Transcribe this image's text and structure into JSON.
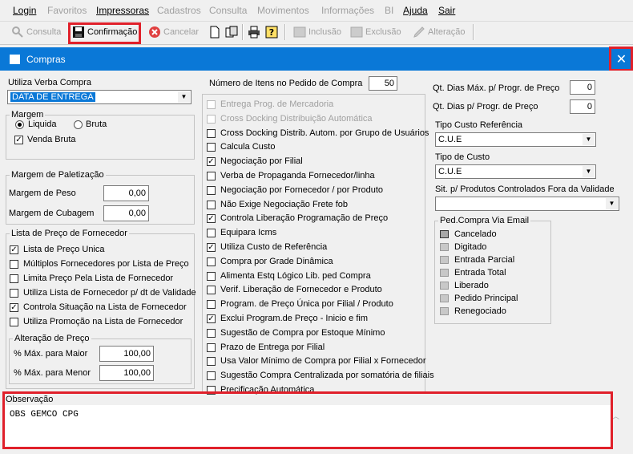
{
  "menu": [
    {
      "label": "Login",
      "enabled": true
    },
    {
      "label": "Favoritos",
      "enabled": false
    },
    {
      "label": "Impressoras",
      "enabled": true
    },
    {
      "label": "Cadastros",
      "enabled": false
    },
    {
      "label": "Consulta",
      "enabled": false
    },
    {
      "label": "Movimentos",
      "enabled": false
    },
    {
      "label": "Informações",
      "enabled": false
    },
    {
      "label": "BI",
      "enabled": false
    },
    {
      "label": "Ajuda",
      "enabled": true
    },
    {
      "label": "Sair",
      "enabled": true
    }
  ],
  "toolbar": {
    "consulta": "Consulta",
    "confirmacao": "Confirmação",
    "cancelar": "Cancelar",
    "inclusao": "Inclusão",
    "exclusao": "Exclusão",
    "alteracao": "Alteração"
  },
  "window": {
    "title": "Compras"
  },
  "col1": {
    "verba_label": "Utiliza Verba Compra",
    "verba_value": "DATA DE ENTREGA",
    "margem_title": "Margem",
    "margem_liquida": "Liquida",
    "margem_bruta": "Bruta",
    "venda_bruta": "Venda Bruta",
    "paletizacao_title": "Margem de Paletização",
    "margem_peso_label": "Margem de Peso",
    "margem_peso_value": "0,00",
    "margem_cubagem_label": "Margem de Cubagem",
    "margem_cubagem_value": "0,00",
    "lista_title": "Lista de Preço de Fornecedor",
    "lista_items": [
      {
        "label": "Lista de Preço Unica",
        "checked": true
      },
      {
        "label": "Múltiplos Fornecedores por Lista de Preço",
        "checked": false
      },
      {
        "label": "Limita Preço Pela Lista de Fornecedor",
        "checked": false
      },
      {
        "label": "Utiliza Lista de Fornecedor p/ dt de Validade",
        "checked": false
      },
      {
        "label": "Controla Situação na Lista de Fornecedor",
        "checked": true
      },
      {
        "label": "Utiliza Promoção na Lista de Fornecedor",
        "checked": false
      }
    ],
    "alteracao_title": "Alteração de Preço",
    "max_maior_label": "% Máx. para Maior",
    "max_maior_value": "100,00",
    "max_menor_label": "% Máx. para Menor",
    "max_menor_value": "100,00"
  },
  "col2": {
    "itens_label": "Número de Itens no Pedido de Compra",
    "itens_value": "50",
    "options": [
      {
        "label": "Entrega Prog. de Mercadoria",
        "checked": false,
        "enabled": false
      },
      {
        "label": "Cross Docking Distribuição Automática",
        "checked": false,
        "enabled": false
      },
      {
        "label": "Cross Docking Distrib. Autom. por Grupo de Usuários",
        "checked": false,
        "enabled": true
      },
      {
        "label": "Calcula Custo",
        "checked": false,
        "enabled": true
      },
      {
        "label": "Negociação por Filial",
        "checked": true,
        "enabled": true
      },
      {
        "label": "Verba de Propaganda Fornecedor/linha",
        "checked": false,
        "enabled": true
      },
      {
        "label": "Negociação por Fornecedor / por Produto",
        "checked": false,
        "enabled": true
      },
      {
        "label": "Não Exige Negociação Frete fob",
        "checked": false,
        "enabled": true
      },
      {
        "label": "Controla Liberação Programação de Preço",
        "checked": true,
        "enabled": true
      },
      {
        "label": "Equipara Icms",
        "checked": false,
        "enabled": true
      },
      {
        "label": "Utiliza Custo de Referência",
        "checked": true,
        "enabled": true
      },
      {
        "label": "Compra por Grade Dinâmica",
        "checked": false,
        "enabled": true
      },
      {
        "label": "Alimenta Estq Lógico Lib. ped Compra",
        "checked": false,
        "enabled": true
      },
      {
        "label": "Verif. Liberação de Fornecedor e Produto",
        "checked": false,
        "enabled": true
      },
      {
        "label": "Program. de Preço Única por Filial / Produto",
        "checked": false,
        "enabled": true
      },
      {
        "label": "Exclui Program.de Preço - Inicio e fim",
        "checked": true,
        "enabled": true
      },
      {
        "label": "Sugestão de Compra por Estoque Mínimo",
        "checked": false,
        "enabled": true
      },
      {
        "label": "Prazo de Entrega por Filial",
        "checked": false,
        "enabled": true
      },
      {
        "label": "Usa Valor Mínimo de Compra por Filial x Fornecedor",
        "checked": false,
        "enabled": true
      },
      {
        "label": "Sugestão Compra Centralizada por somatória de filiais",
        "checked": false,
        "enabled": true
      },
      {
        "label": "Precificação Automática",
        "checked": false,
        "enabled": true
      }
    ]
  },
  "col3": {
    "dias_max_label": "Qt. Dias Máx. p/ Progr. de Preço",
    "dias_max_value": "0",
    "dias_label": "Qt. Dias p/ Progr. de Preço",
    "dias_value": "0",
    "tipo_ref_label": "Tipo Custo Referência",
    "tipo_ref_value": "C.U.E",
    "tipo_custo_label": "Tipo de Custo",
    "tipo_custo_value": "C.U.E",
    "sit_label": "Sit. p/ Produtos Controlados Fora da Validade",
    "sit_value": "",
    "email_title": "Ped.Compra Via Email",
    "email_items": [
      "Cancelado",
      "Digitado",
      "Entrada Parcial",
      "Entrada Total",
      "Liberado",
      "Pedido Principal",
      "Renegociado"
    ]
  },
  "obs": {
    "label": "Observação",
    "value": "OBS GEMCO CPG"
  }
}
